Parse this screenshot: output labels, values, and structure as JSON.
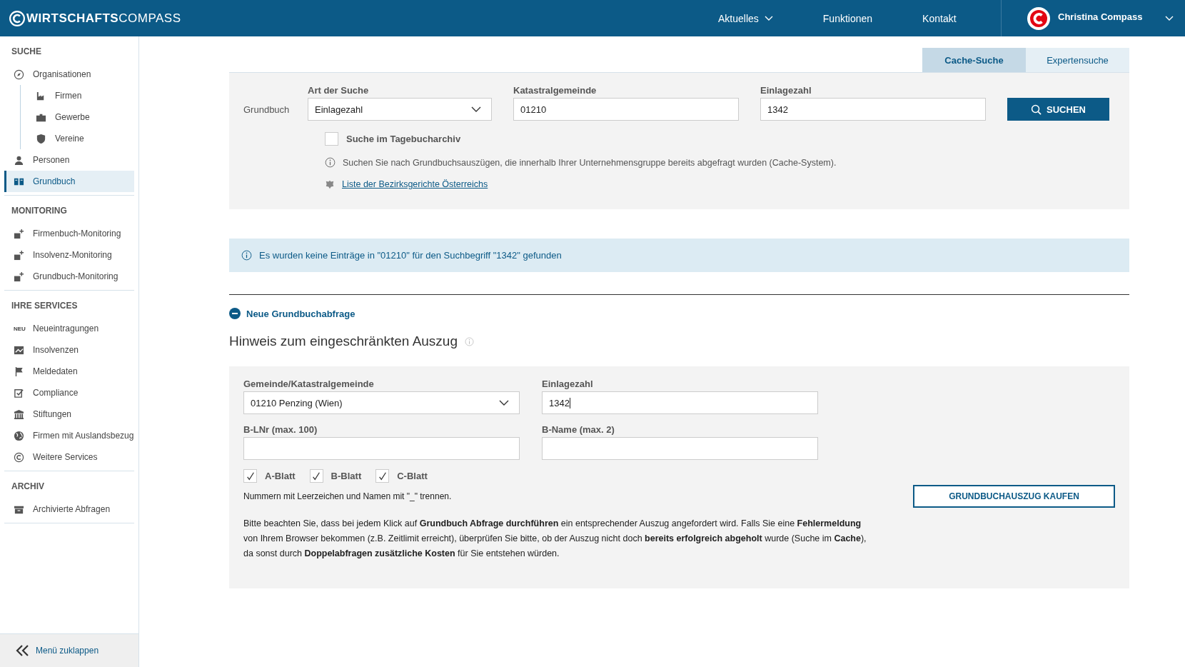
{
  "header": {
    "logo_bold": "WIRTSCHAFTS",
    "logo_light": "COMPASS",
    "nav": [
      {
        "label": "Aktuelles",
        "dropdown": true
      },
      {
        "label": "Funktionen",
        "dropdown": false
      },
      {
        "label": "Kontakt",
        "dropdown": false
      }
    ],
    "user": "Christina Compass"
  },
  "sidebar": {
    "sections": [
      {
        "title": "SUCHE",
        "items": [
          {
            "label": "Organisationen",
            "selected": false,
            "children": [
              {
                "label": "Firmen",
                "selected": false
              },
              {
                "label": "Gewerbe",
                "selected": false
              },
              {
                "label": "Vereine",
                "selected": false
              }
            ]
          },
          {
            "label": "Personen",
            "selected": false
          },
          {
            "label": "Grundbuch",
            "selected": true
          }
        ]
      },
      {
        "title": "MONITORING",
        "items": [
          {
            "label": "Firmenbuch-Monitoring",
            "selected": false
          },
          {
            "label": "Insolvenz-Monitoring",
            "selected": false
          },
          {
            "label": "Grundbuch-Monitoring",
            "selected": false
          }
        ]
      },
      {
        "title": "IHRE SERVICES",
        "items": [
          {
            "label": "Neueintragungen",
            "selected": false,
            "badge": "NEU"
          },
          {
            "label": "Insolvenzen",
            "selected": false
          },
          {
            "label": "Meldedaten",
            "selected": false
          },
          {
            "label": "Compliance",
            "selected": false
          },
          {
            "label": "Stiftungen",
            "selected": false
          },
          {
            "label": "Firmen mit Auslandsbezug",
            "selected": false
          },
          {
            "label": "Weitere Services",
            "selected": false
          }
        ]
      },
      {
        "title": "ARCHIV",
        "items": [
          {
            "label": "Archivierte Abfragen",
            "selected": false
          }
        ]
      }
    ],
    "collapse": "Menü zuklappen"
  },
  "tabs": [
    {
      "label": "Cache-Suche",
      "selected": true
    },
    {
      "label": "Expertensuche",
      "selected": false
    }
  ],
  "search": {
    "row_label": "Grundbuch",
    "art": {
      "label": "Art der Suche",
      "value": "Einlagezahl"
    },
    "kg": {
      "label": "Katastralgemeinde",
      "value": "01210"
    },
    "ez": {
      "label": "Einlagezahl",
      "value": "1342"
    },
    "button": "SUCHEN",
    "archive": {
      "label": "Suche im Tagebucharchiv",
      "checked": false
    },
    "info": "Suchen Sie nach Grundbuchsauszügen, die innerhalb Ihrer Unternehmensgruppe bereits abgefragt wurden (Cache-System).",
    "link": "Liste der Bezirksgerichte Österreichs"
  },
  "notice": "Es wurden keine Einträge in \"01210\" für den Suchbegriff \"1342\" gefunden",
  "new_query": {
    "toggle": "Neue Grundbuchabfrage",
    "expanded": true,
    "heading": "Hinweis zum eingeschränkten Auszug",
    "gemeinde": {
      "label": "Gemeinde/Katastralgemeinde",
      "value": "01210 Penzing (Wien)"
    },
    "ez": {
      "label": "Einlagezahl",
      "value": "1342"
    },
    "blnr": {
      "label": "B-LNr (max. 100)"
    },
    "bname": {
      "label": "B-Name (max. 2)"
    },
    "sheets": [
      {
        "label": "A-Blatt",
        "checked": true
      },
      {
        "label": "B-Blatt",
        "checked": true
      },
      {
        "label": "C-Blatt",
        "checked": true
      }
    ],
    "hint": "Nummern mit Leerzeichen und Namen mit \"_\" trennen.",
    "note": "Bitte beachten Sie, dass bei jedem Klick auf **Grundbuch Abfrage durchführen** ein entsprechender Auszug angefordert wird. Falls Sie eine **Fehlermeldung** von Ihrem Browser bekommen (z.B. Zeitlimit erreicht), überprüfen Sie bitte, ob der Auszug nicht doch **bereits erfolgreich abgeholt** wurde (Suche im **Cache**), da sonst durch **Doppelabfragen zusätzliche Kosten** für Sie entstehen würden.",
    "buy": "GRUNDBUCHAUSZUG KAUFEN"
  }
}
